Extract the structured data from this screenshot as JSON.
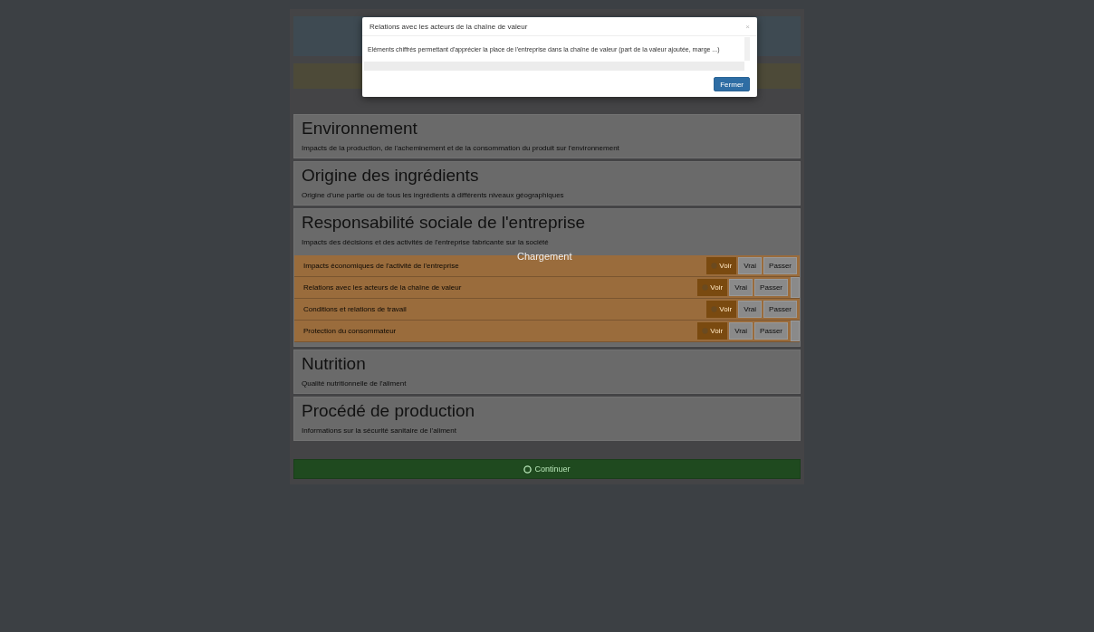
{
  "modal": {
    "title": "Relations avec les acteurs de la chaîne de valeur",
    "close": "×",
    "body": "Eléments chiffrés permettant d'apprécier la place de l'entreprise dans la chaîne de valeur (part de la valeur ajoutée, marge ...)",
    "button": "Fermer"
  },
  "loading": "Chargement",
  "sections": [
    {
      "title": "Environnement",
      "description": "Impacts de la production, de l'acheminement et de la consommation du produit sur l'environnement"
    },
    {
      "title": "Origine des ingrédients",
      "description": "Origine d'une partie ou de tous les ingrédients à différents niveaux géographiques"
    },
    {
      "title": "Responsabilité sociale de l'entreprise",
      "description": "Impacts des décisions et des activités de l'entreprise fabricante sur la société",
      "items": [
        {
          "label": "Impacts économiques de l'activité de l'entreprise",
          "info": "Voir",
          "yes": "Vrai",
          "skip": "Passer",
          "scroll": false
        },
        {
          "label": "Relations avec les acteurs de la chaîne de valeur",
          "info": "Voir",
          "yes": "Vrai",
          "skip": "Passer",
          "scroll": true
        },
        {
          "label": "Conditions et relations de travail",
          "info": "Voir",
          "yes": "Vrai",
          "skip": "Passer",
          "scroll": false
        },
        {
          "label": "Protection du consommateur",
          "info": "Voir",
          "yes": "Vrai",
          "skip": "Passer",
          "scroll": true
        }
      ]
    },
    {
      "title": "Nutrition",
      "description": "Qualité nutritionnelle de l'aliment"
    },
    {
      "title": "Procédé de production",
      "description": "Informations sur la sécurité sanitaire de l'aliment"
    }
  ],
  "continue": "Continuer"
}
